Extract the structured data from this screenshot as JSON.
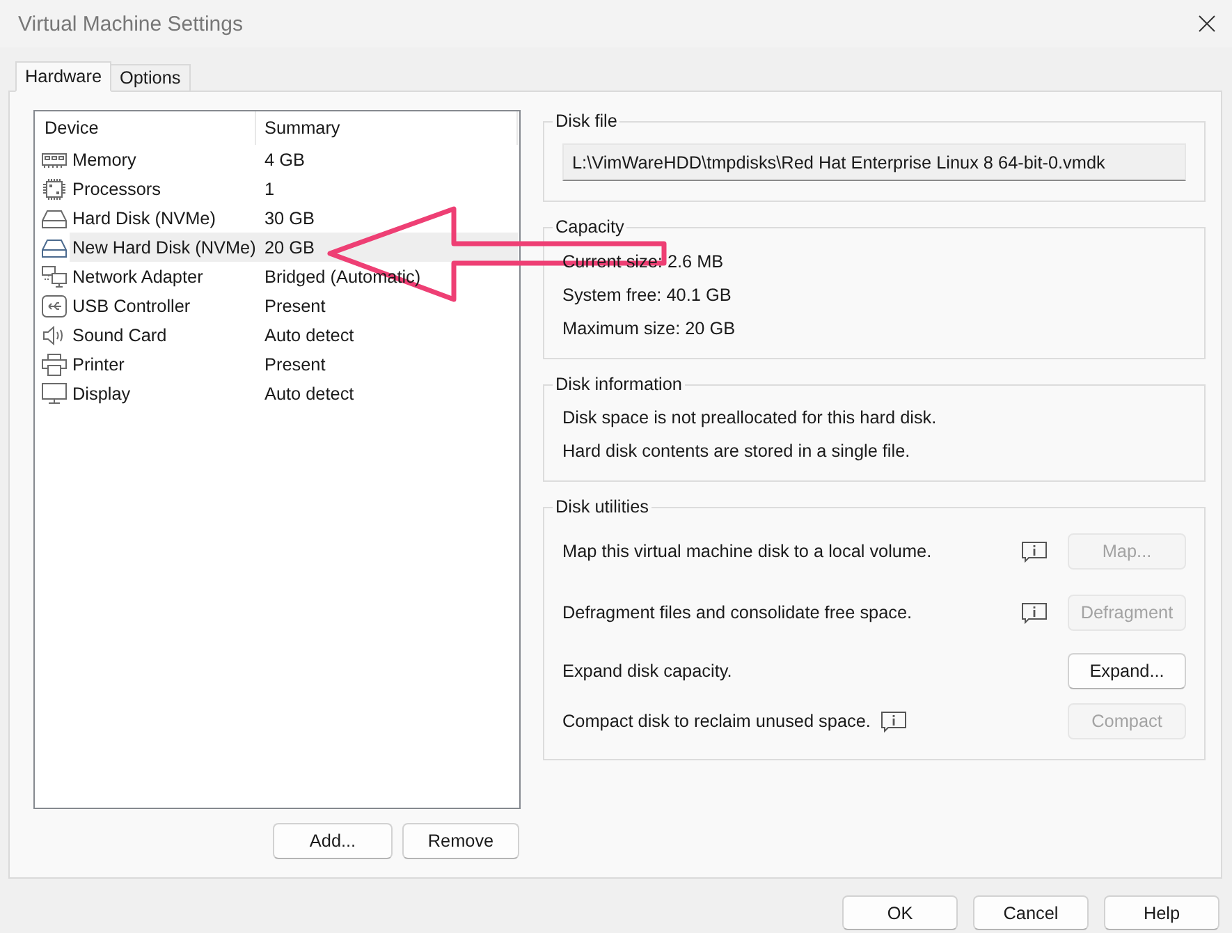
{
  "window": {
    "title": "Virtual Machine Settings"
  },
  "tabs": [
    {
      "label": "Hardware",
      "selected": true
    },
    {
      "label": "Options",
      "selected": false
    }
  ],
  "device_list": {
    "columns": [
      "Device",
      "Summary"
    ],
    "rows": [
      {
        "kind": "memory",
        "device": "Memory",
        "summary": "4 GB",
        "selected": false
      },
      {
        "kind": "processor",
        "device": "Processors",
        "summary": "1",
        "selected": false
      },
      {
        "kind": "disk",
        "device": "Hard Disk (NVMe)",
        "summary": "30 GB",
        "selected": false
      },
      {
        "kind": "disk",
        "device": "New Hard Disk (NVMe)",
        "summary": "20 GB",
        "selected": true
      },
      {
        "kind": "network",
        "device": "Network Adapter",
        "summary": "Bridged (Automatic)",
        "selected": false
      },
      {
        "kind": "usb",
        "device": "USB Controller",
        "summary": "Present",
        "selected": false
      },
      {
        "kind": "sound",
        "device": "Sound Card",
        "summary": "Auto detect",
        "selected": false
      },
      {
        "kind": "printer",
        "device": "Printer",
        "summary": "Present",
        "selected": false
      },
      {
        "kind": "display",
        "device": "Display",
        "summary": "Auto detect",
        "selected": false
      }
    ]
  },
  "list_buttons": [
    "Add...",
    "Remove"
  ],
  "disk_file": {
    "title": "Disk file",
    "value": "L:\\VimWareHDD\\tmpdisks\\Red Hat Enterprise Linux 8 64-bit-0.vmdk"
  },
  "capacity": {
    "title": "Capacity",
    "lines": [
      "Current size: 2.6 MB",
      "System free: 40.1 GB",
      "Maximum size: 20 GB"
    ]
  },
  "disk_information": {
    "title": "Disk information",
    "lines": [
      "Disk space is not preallocated for this hard disk.",
      "Hard disk contents are stored in a single file."
    ]
  },
  "disk_utilities": {
    "title": "Disk utilities",
    "rows": [
      {
        "kind": "column",
        "text": "Map this virtual machine disk to a local volume.",
        "button": "Map...",
        "disabled": true
      },
      {
        "kind": "column",
        "text": "Defragment files and consolidate free space.",
        "button": "Defragment",
        "disabled": true
      },
      {
        "kind": "plain",
        "text": "Expand disk capacity.",
        "button": "Expand...",
        "disabled": false
      },
      {
        "kind": "inline",
        "text": "Compact disk to reclaim unused space.",
        "button": "Compact",
        "disabled": true
      }
    ]
  },
  "dialog_buttons": [
    "OK",
    "Cancel",
    "Help"
  ]
}
